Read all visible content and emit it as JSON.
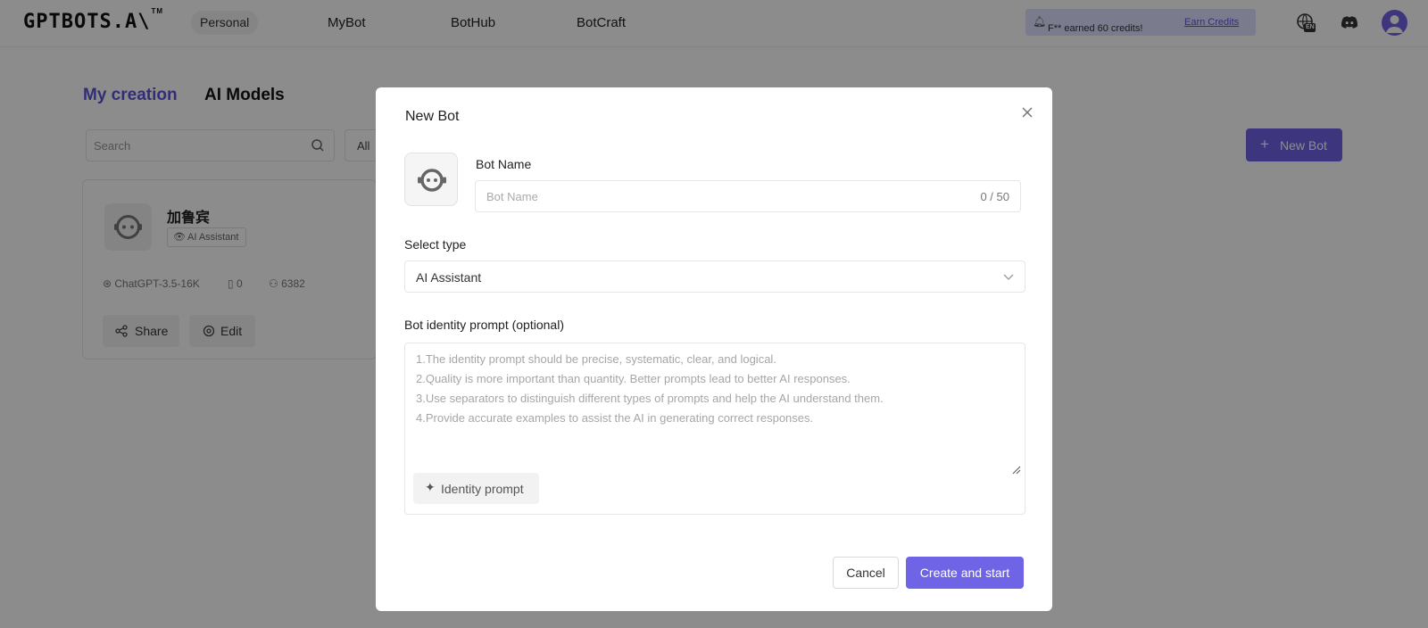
{
  "header": {
    "logo_text": "GPTBOTS.A\\",
    "logo_tm": "TM",
    "workspace": "Personal",
    "nav": [
      "MyBot",
      "BotHub",
      "BotCraft"
    ],
    "credits_message": "F** earned 60 credits!",
    "earn_credits_link": "Earn Credits",
    "language_badge": "EN"
  },
  "page": {
    "tabs": [
      "My creation",
      "AI Models"
    ],
    "search_placeholder": "Search",
    "filter_value": "All",
    "new_bot_label": "New Bot",
    "bot_card": {
      "name": "加鲁宾",
      "type_badge": "AI Assistant",
      "model": "ChatGPT-3.5-16K",
      "knowledge_count": "0",
      "user_count": "6382",
      "share_label": "Share",
      "edit_label": "Edit"
    }
  },
  "modal": {
    "title": "New Bot",
    "bot_name_label": "Bot Name",
    "bot_name_placeholder": "Bot Name",
    "bot_name_counter": "0 / 50",
    "select_type_label": "Select type",
    "select_type_value": "AI Assistant",
    "prompt_label": "Bot identity prompt (optional)",
    "prompt_placeholder_lines": [
      "1.The identity prompt should be precise, systematic, clear, and logical.",
      "2.Quality is more important than quantity. Better prompts lead to better AI responses.",
      "3.Use separators to distinguish different types of prompts and help the AI understand them.",
      "4.Provide accurate examples to assist the AI in generating correct responses."
    ],
    "identity_prompt_button": "Identity prompt",
    "cancel_label": "Cancel",
    "create_label": "Create and start"
  },
  "colors": {
    "accent": "#6f63e6",
    "overlay": "rgba(0,0,0,0.45)",
    "credits_banner": "#dfe1ff"
  }
}
